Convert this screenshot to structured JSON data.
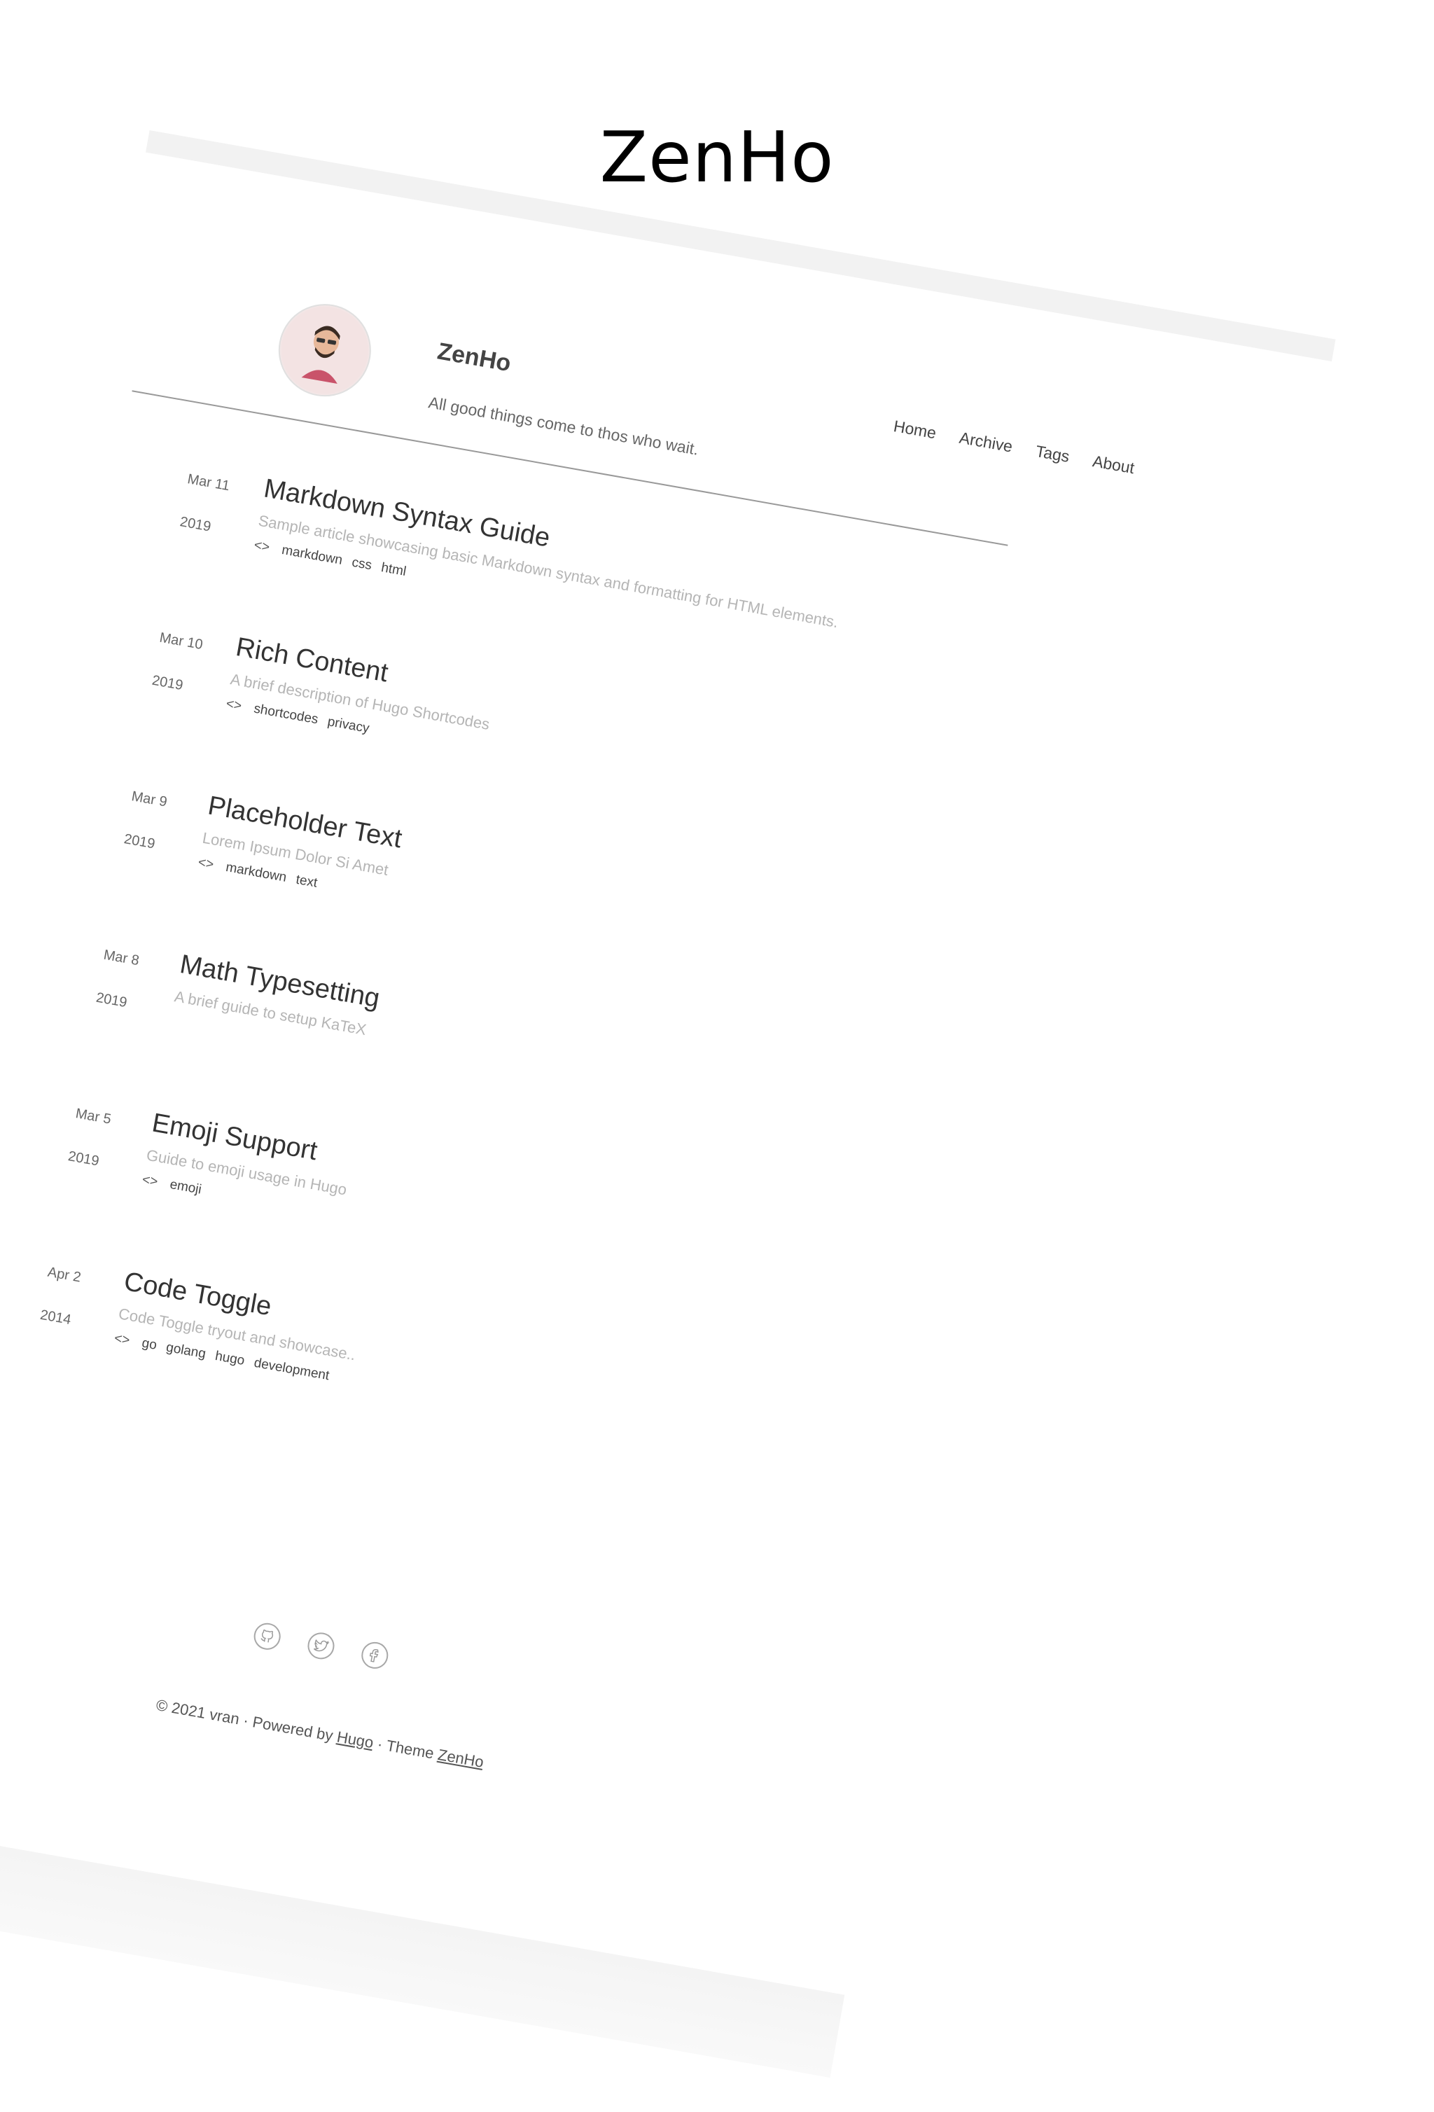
{
  "top_title": "ZenHo",
  "site": {
    "name": "ZenHo",
    "tagline": "All good things come to thos who wait."
  },
  "nav": {
    "items": [
      "Home",
      "Archive",
      "Tags",
      "About"
    ]
  },
  "posts": [
    {
      "date": "Mar 11",
      "year": "2019",
      "title": "Markdown Syntax Guide",
      "desc": "Sample article showcasing basic Markdown syntax and formatting for HTML elements.",
      "tags": [
        "markdown",
        "css",
        "html"
      ]
    },
    {
      "date": "Mar 10",
      "year": "2019",
      "title": "Rich Content",
      "desc": "A brief description of Hugo Shortcodes",
      "tags": [
        "shortcodes",
        "privacy"
      ]
    },
    {
      "date": "Mar 9",
      "year": "2019",
      "title": "Placeholder Text",
      "desc": "Lorem Ipsum Dolor Si Amet",
      "tags": [
        "markdown",
        "text"
      ]
    },
    {
      "date": "Mar 8",
      "year": "2019",
      "title": "Math Typesetting",
      "desc": "A brief guide to setup KaTeX",
      "tags": []
    },
    {
      "date": "Mar 5",
      "year": "2019",
      "title": "Emoji Support",
      "desc": "Guide to emoji usage in Hugo",
      "tags": [
        "emoji"
      ]
    },
    {
      "date": "Apr 2",
      "year": "2014",
      "title": "Code Toggle",
      "desc": "Code Toggle tryout and showcase..",
      "tags": [
        "go",
        "golang",
        "hugo",
        "development"
      ]
    }
  ],
  "footer": {
    "copyright_prefix": "© 2021 vran · Powered by",
    "powered_by_link": "Hugo",
    "theme_prefix": "· Theme",
    "theme_link": "ZenHo"
  },
  "social_icons": [
    "github-icon",
    "twitter-icon",
    "facebook-icon"
  ]
}
